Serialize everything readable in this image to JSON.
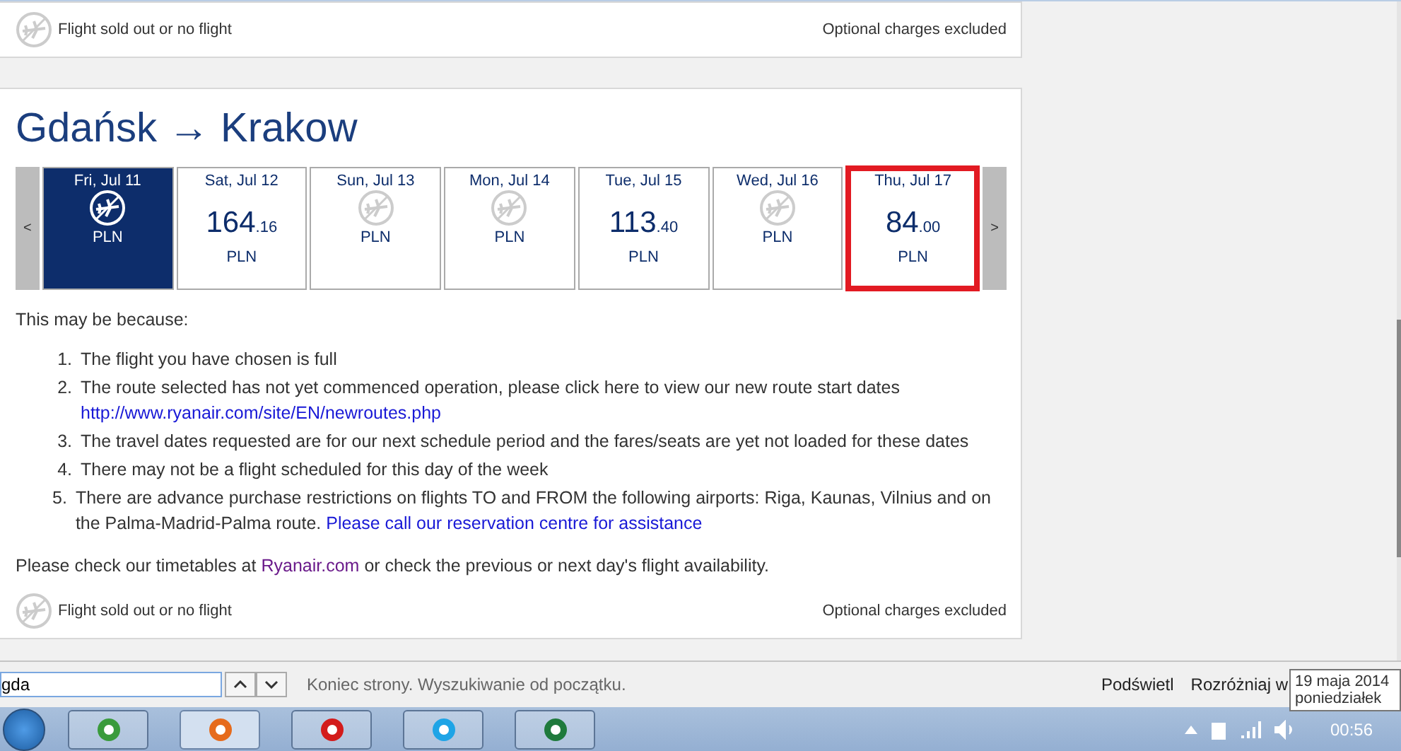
{
  "top_card": {
    "legend": "Flight sold out or no flight",
    "note": "Optional charges excluded"
  },
  "route": {
    "title": "Gdańsk → Krakow",
    "prev": "<",
    "next": ">",
    "days": [
      {
        "date": "Fri, Jul 11",
        "kind": "noflight",
        "currency": "PLN",
        "selected": true,
        "highlighted": false
      },
      {
        "date": "Sat, Jul 12",
        "kind": "price",
        "amount": "164",
        "decimals": ".16",
        "currency": "PLN",
        "selected": false,
        "highlighted": false
      },
      {
        "date": "Sun, Jul 13",
        "kind": "noflight",
        "currency": "PLN",
        "selected": false,
        "highlighted": false
      },
      {
        "date": "Mon, Jul 14",
        "kind": "noflight",
        "currency": "PLN",
        "selected": false,
        "highlighted": false
      },
      {
        "date": "Tue, Jul 15",
        "kind": "price",
        "amount": "113",
        "decimals": ".40",
        "currency": "PLN",
        "selected": false,
        "highlighted": false
      },
      {
        "date": "Wed, Jul 16",
        "kind": "noflight",
        "currency": "PLN",
        "selected": false,
        "highlighted": false
      },
      {
        "date": "Thu, Jul 17",
        "kind": "price",
        "amount": "84",
        "decimals": ".00",
        "currency": "PLN",
        "selected": false,
        "highlighted": true
      }
    ],
    "intro": "This may be because:",
    "reasons": [
      {
        "num": "1.",
        "text": "The flight you have chosen is full"
      },
      {
        "num": "2.",
        "text": "The route selected has not yet commenced operation, please click here to view our new route start dates",
        "link": "http://www.ryanair.com/site/EN/newroutes.php"
      },
      {
        "num": "3.",
        "text": "The travel dates requested are for our next schedule period and the fares/seats are yet not loaded for these dates"
      },
      {
        "num": "4.",
        "text": "There may not be a flight scheduled for this day of the week"
      },
      {
        "num": "5.",
        "text": "There are advance purchase restrictions on flights TO and FROM the following airports: Riga, Kaunas, Vilnius and on the Palma-Madrid-Palma route.",
        "link": "Please call our reservation centre for assistance"
      }
    ],
    "check_before": "Please check our timetables at",
    "check_link": "Ryanair.com",
    "check_after": "or check the previous or next day's flight availability.",
    "legend": "Flight sold out or no flight",
    "note": "Optional charges excluded"
  },
  "find_bar": {
    "value": "gda",
    "message": "Koniec strony. Wyszukiwanie od początku.",
    "highlight": "Podświetl",
    "match_case": "Rozróżniaj w"
  },
  "taskbar": {
    "apps": [
      {
        "kind": "chrome",
        "selected": false
      },
      {
        "kind": "firefox",
        "selected": true
      },
      {
        "kind": "opera",
        "selected": false
      },
      {
        "kind": "skype",
        "selected": false
      },
      {
        "kind": "excel",
        "selected": false
      }
    ],
    "time": "00:56"
  },
  "tooltip": {
    "date": "19 maja 2014",
    "day": "poniedziałek"
  }
}
